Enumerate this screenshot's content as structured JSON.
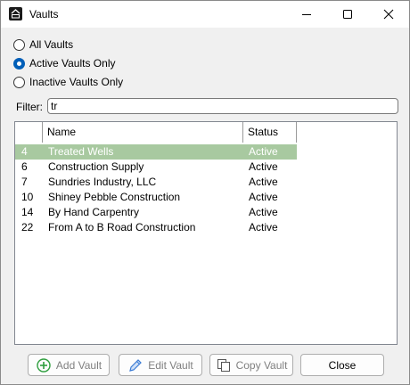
{
  "window": {
    "title": "Vaults",
    "icon": "app-logo-icon"
  },
  "titlebar_buttons": {
    "minimize": "minimize-icon",
    "maximize": "maximize-icon",
    "close": "close-icon"
  },
  "radios": [
    {
      "label": "All Vaults",
      "checked": false
    },
    {
      "label": "Active Vaults Only",
      "checked": true
    },
    {
      "label": "Inactive Vaults Only",
      "checked": false
    }
  ],
  "filter": {
    "label": "Filter:",
    "value": "tr"
  },
  "table": {
    "columns": [
      "",
      "Name",
      "Status"
    ],
    "rows": [
      {
        "id": "4",
        "name": "Treated Wells",
        "status": "Active",
        "selected": true
      },
      {
        "id": "6",
        "name": "Construction Supply",
        "status": "Active",
        "selected": false
      },
      {
        "id": "7",
        "name": "Sundries Industry, LLC",
        "status": "Active",
        "selected": false
      },
      {
        "id": "10",
        "name": "Shiney Pebble Construction",
        "status": "Active",
        "selected": false
      },
      {
        "id": "14",
        "name": "By Hand Carpentry",
        "status": "Active",
        "selected": false
      },
      {
        "id": "22",
        "name": "From A to B Road Construction",
        "status": "Active",
        "selected": false
      }
    ]
  },
  "buttons": {
    "add": "Add Vault",
    "edit": "Edit Vault",
    "copy": "Copy Vault",
    "close": "Close"
  },
  "colors": {
    "selection": "#a8c9a0",
    "accent": "#005fb8",
    "add_icon": "#2e9e3e",
    "edit_icon": "#3a7bd5"
  }
}
